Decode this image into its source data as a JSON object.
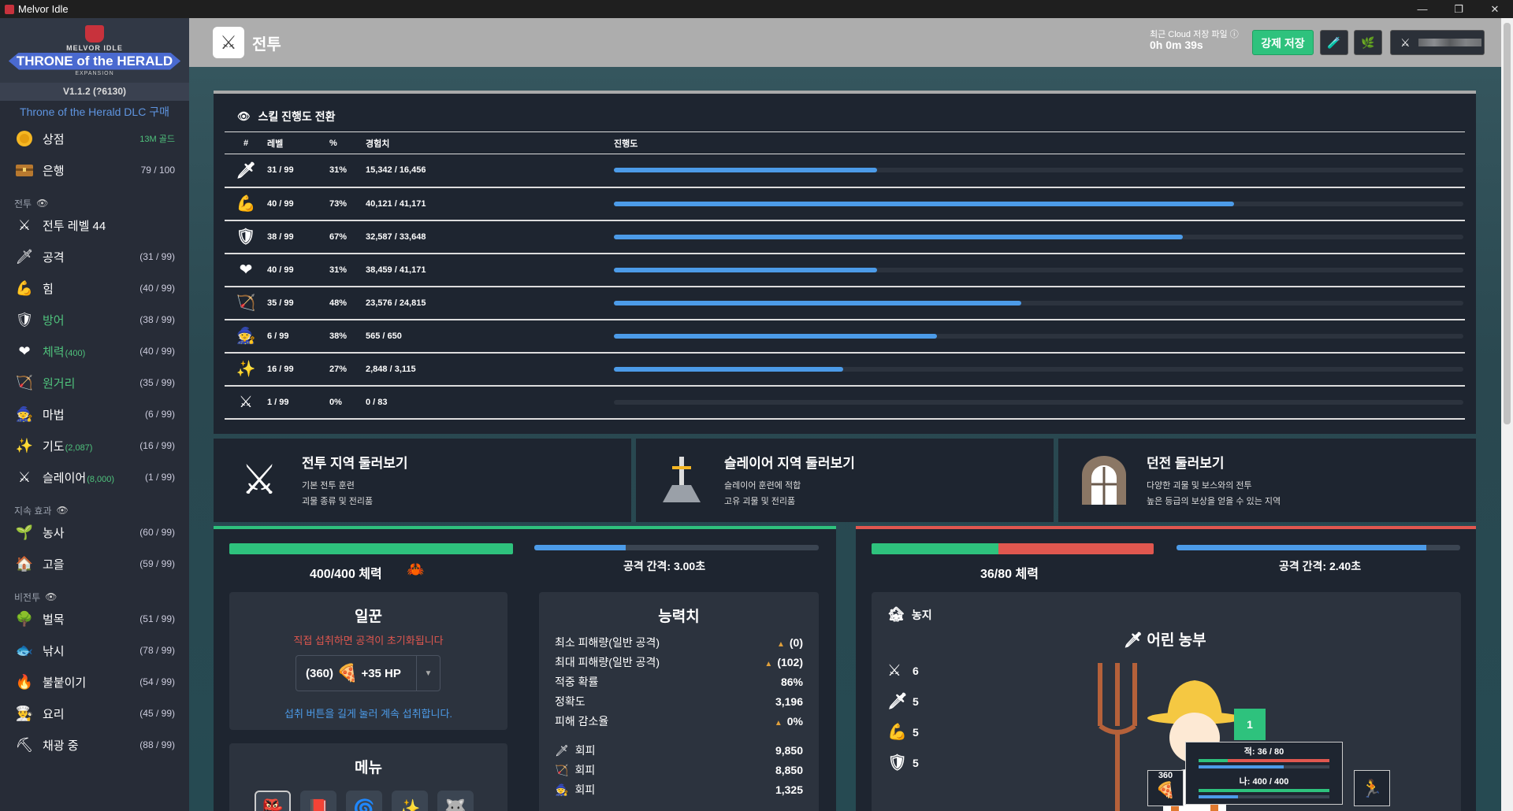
{
  "window": {
    "title": "Melvor Idle",
    "minimize": "—",
    "restore": "❐",
    "close": "✕"
  },
  "logo": {
    "line1": "MELVOR IDLE",
    "line2": "THRONE of the HERALD",
    "line3": "EXPANSION"
  },
  "version": "V1.1.2 (?6130)",
  "dlc_link": "Throne of the Herald DLC 구매",
  "sidebar": {
    "shop": {
      "label": "상점",
      "gold": "13M 골드"
    },
    "bank": {
      "label": "은행",
      "count": "79 / 100"
    },
    "combat_head": "전투",
    "combat_level": "전투 레벨 44",
    "skills": [
      {
        "label": "공격",
        "level": "(31 / 99)",
        "icon": "sword"
      },
      {
        "label": "힘",
        "level": "(40 / 99)",
        "icon": "arm"
      },
      {
        "label": "방어",
        "level": "(38 / 99)",
        "icon": "shield"
      },
      {
        "label": "체력",
        "sub": "(400)",
        "level": "(40 / 99)",
        "icon": "heart"
      },
      {
        "label": "원거리",
        "level": "(35 / 99)",
        "icon": "bow"
      },
      {
        "label": "마법",
        "level": "(6 / 99)",
        "icon": "wizard-hat"
      },
      {
        "label": "기도",
        "sub": "(2,087)",
        "level": "(16 / 99)",
        "icon": "sparkle"
      },
      {
        "label": "슬레이어",
        "sub": "(8,000)",
        "level": "(1 / 99)",
        "icon": "slayer-sword"
      }
    ],
    "passive_head": "지속 효과",
    "passive": [
      {
        "label": "농사",
        "level": "(60 / 99)",
        "icon": "sprout"
      },
      {
        "label": "고을",
        "level": "(59 / 99)",
        "icon": "town"
      }
    ],
    "noncombat_head": "비전투",
    "noncombat": [
      {
        "label": "벌목",
        "level": "(51 / 99)",
        "icon": "tree"
      },
      {
        "label": "낚시",
        "level": "(78 / 99)",
        "icon": "fish"
      },
      {
        "label": "불붙이기",
        "level": "(54 / 99)",
        "icon": "fire"
      },
      {
        "label": "요리",
        "level": "(45 / 99)",
        "icon": "chef-hat"
      },
      {
        "label": "채광 중",
        "level": "(88 / 99)",
        "icon": "pickaxe"
      }
    ]
  },
  "header": {
    "title": "전투",
    "cloud_label": "최근 Cloud 저장 파일",
    "cloud_time": "0h 0m 39s",
    "force_save": "강제 저장"
  },
  "skill_progress": {
    "title": "스킬 진행도 전환",
    "columns": [
      "#",
      "레벨",
      "%",
      "경험치",
      "진행도"
    ],
    "rows": [
      {
        "icon": "sword",
        "level": "31 / 99",
        "pct": "31%",
        "xp": "15,342 / 16,456",
        "progress": 0.31
      },
      {
        "icon": "arm",
        "level": "40 / 99",
        "pct": "73%",
        "xp": "40,121 / 41,171",
        "progress": 0.73
      },
      {
        "icon": "shield",
        "level": "38 / 99",
        "pct": "67%",
        "xp": "32,587 / 33,648",
        "progress": 0.67
      },
      {
        "icon": "heart",
        "level": "40 / 99",
        "pct": "31%",
        "xp": "38,459 / 41,171",
        "progress": 0.31
      },
      {
        "icon": "bow",
        "level": "35 / 99",
        "pct": "48%",
        "xp": "23,576 / 24,815",
        "progress": 0.48
      },
      {
        "icon": "wizard-hat",
        "level": "6 / 99",
        "pct": "38%",
        "xp": "565 / 650",
        "progress": 0.38
      },
      {
        "icon": "sparkle",
        "level": "16 / 99",
        "pct": "27%",
        "xp": "2,848 / 3,115",
        "progress": 0.27
      },
      {
        "icon": "slayer-sword",
        "level": "1 / 99",
        "pct": "0%",
        "xp": "0 / 83",
        "progress": 0.0
      }
    ]
  },
  "areas": [
    {
      "title": "전투 지역 둘러보기",
      "desc1": "기본 전투 훈련",
      "desc2": "괴물 종류 및 전리품",
      "icon": "crossed-swords"
    },
    {
      "title": "슬레이어 지역 둘러보기",
      "desc1": "슬레이어 훈련에 적합",
      "desc2": "고유 괴물 및 전리품",
      "icon": "sword-in-stone"
    },
    {
      "title": "던전 둘러보기",
      "desc1": "다양한 괴물 및 보스와의 전투",
      "desc2": "높은 등급의 보상을 얻을 수 있는 지역",
      "icon": "dungeon-door"
    }
  ],
  "player": {
    "hp_label": "400/400 체력",
    "hp_fraction": 1.0,
    "attack_interval": "공격 간격: 3.00초",
    "attack_progress": 0.32,
    "food": {
      "title": "일꾼",
      "warning": "직접 섭취하면 공격이 초기화됩니다",
      "qty": "(360)",
      "heal": "+35 HP",
      "hint": "섭취 버튼을 길게 눌러 계속 섭취합니다."
    },
    "stats_title": "능력치",
    "stats": [
      {
        "label": "최소 피해량(일반 공격)",
        "value": "(0)"
      },
      {
        "label": "최대 피해량(일반 공격)",
        "value": "(102)"
      },
      {
        "label": "적중 확률",
        "value": "86%"
      },
      {
        "label": "정확도",
        "value": "3,196"
      },
      {
        "label": "피해 감소율",
        "value": "0%"
      }
    ],
    "evasion": [
      {
        "label": "회피",
        "value": "9,850",
        "icon": "sword"
      },
      {
        "label": "회피",
        "value": "8,850",
        "icon": "bow"
      },
      {
        "label": "회피",
        "value": "1,325",
        "icon": "wizard-hat"
      }
    ],
    "menu_title": "메뉴"
  },
  "enemy": {
    "hp_label": "36/80 체력",
    "hp_fraction": 0.45,
    "attack_interval": "공격 간격: 2.40초",
    "attack_progress": 0.88,
    "area": "농지",
    "name": "어린 농부",
    "stats": [
      {
        "icon": "crossed-swords",
        "value": "6"
      },
      {
        "icon": "sword",
        "value": "5"
      },
      {
        "icon": "arm",
        "value": "5"
      },
      {
        "icon": "shield",
        "value": "5"
      }
    ],
    "badge": "1",
    "mini_enemy": "적: 36 / 80",
    "mini_player": "나: 400 / 400",
    "food_qty": "360"
  },
  "colors": {
    "accent_green": "#2ec27d",
    "enemy_red": "#e0574f",
    "progress_blue": "#4c9be8"
  }
}
